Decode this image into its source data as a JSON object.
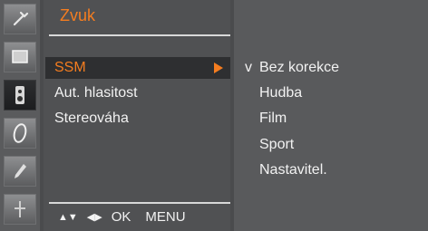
{
  "menu": {
    "title": "Zvuk",
    "items": [
      {
        "label": "SSM",
        "selected": true
      },
      {
        "label": "Aut. hlasitost",
        "selected": false
      },
      {
        "label": "Stereováha",
        "selected": false
      }
    ]
  },
  "submenu": {
    "check_mark": "v",
    "items": [
      {
        "label": "Bez korekce",
        "checked": true
      },
      {
        "label": "Hudba",
        "checked": false
      },
      {
        "label": "Film",
        "checked": false
      },
      {
        "label": "Sport",
        "checked": false
      },
      {
        "label": "Nastavitel.",
        "checked": false
      }
    ]
  },
  "footer": {
    "updown_glyph": "▲▼",
    "leftright_glyph": "◀▶",
    "ok_label": "OK",
    "menu_label": "MENU"
  },
  "icons": [
    "tools-icon",
    "screen-icon",
    "speaker-icon",
    "clock-icon",
    "key-icon",
    "input-icon"
  ],
  "colors": {
    "accent": "#f47d20",
    "text": "#f2f2f2",
    "panel": "#505153"
  }
}
